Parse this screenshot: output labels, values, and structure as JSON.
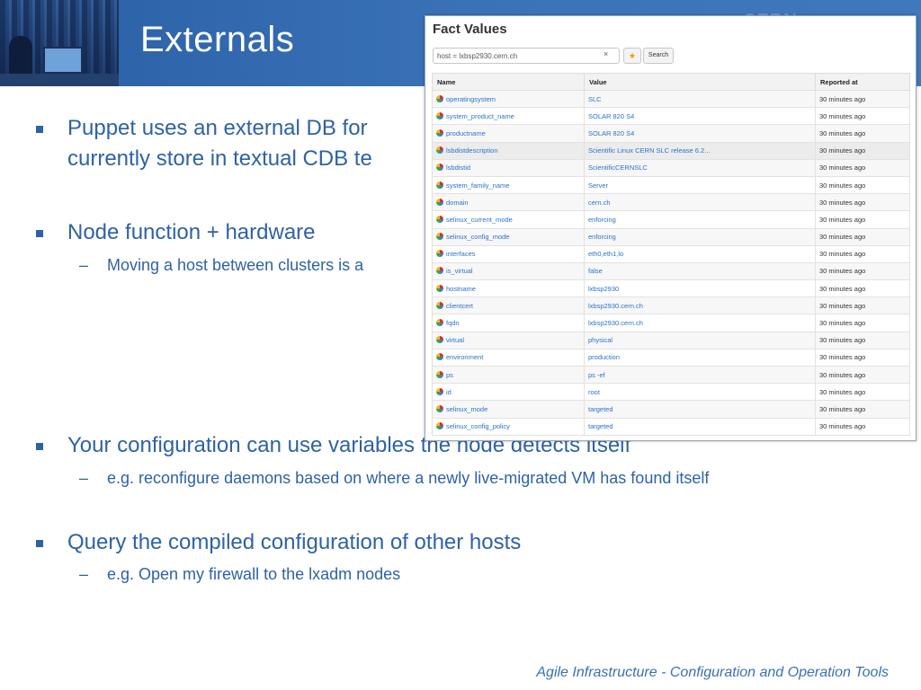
{
  "slide": {
    "title": "Externals",
    "logo_text": "CERN",
    "footer": "Agile Infrastructure - Configuration and Operation Tools",
    "bullets": [
      {
        "line1": "Puppet uses an external DB for",
        "line2": "currently store in textual CDB te"
      },
      {
        "text": "Node function + hardware",
        "sub": "Moving a host between clusters is a"
      },
      {
        "text": "Your configuration can use variables the node detects itself",
        "sub": "e.g. reconfigure daemons based on where a newly live-migrated VM has found itself"
      },
      {
        "text": "Query the compiled configuration of other hosts",
        "sub": "e.g. Open my firewall to the lxadm nodes"
      }
    ]
  },
  "fact_panel": {
    "title": "Fact Values",
    "search_value": "host = lxbsp2930.cern.ch",
    "clear_glyph": "×",
    "star_glyph": "★",
    "search_label": "Search",
    "columns": [
      "Name",
      "Value",
      "Reported at"
    ],
    "rows": [
      {
        "name": "operatingsystem",
        "value": "SLC",
        "reported": "30 minutes ago"
      },
      {
        "name": "system_product_name",
        "value": "SOLAR 820 S4",
        "reported": "30 minutes ago"
      },
      {
        "name": "productname",
        "value": "SOLAR 820 S4",
        "reported": "30 minutes ago"
      },
      {
        "name": "lsbdistdescription",
        "value": "Scientific Linux CERN SLC release 6.2...",
        "reported": "30 minutes ago"
      },
      {
        "name": "lsbdistid",
        "value": "ScientificCERNSLC",
        "reported": "30 minutes ago"
      },
      {
        "name": "system_family_name",
        "value": "Server",
        "reported": "30 minutes ago"
      },
      {
        "name": "domain",
        "value": "cern.ch",
        "reported": "30 minutes ago"
      },
      {
        "name": "selinux_current_mode",
        "value": "enforcing",
        "reported": "30 minutes ago"
      },
      {
        "name": "selinux_config_mode",
        "value": "enforcing",
        "reported": "30 minutes ago"
      },
      {
        "name": "interfaces",
        "value": "eth0,eth1,lo",
        "reported": "30 minutes ago"
      },
      {
        "name": "is_virtual",
        "value": "false",
        "reported": "30 minutes ago"
      },
      {
        "name": "hostname",
        "value": "lxbsp2930",
        "reported": "30 minutes ago"
      },
      {
        "name": "clientcert",
        "value": "lxbsp2930.cern.ch",
        "reported": "30 minutes ago"
      },
      {
        "name": "fqdn",
        "value": "lxbsp2930.cern.ch",
        "reported": "30 minutes ago"
      },
      {
        "name": "virtual",
        "value": "physical",
        "reported": "30 minutes ago"
      },
      {
        "name": "environment",
        "value": "production",
        "reported": "30 minutes ago"
      },
      {
        "name": "ps",
        "value": "ps -ef",
        "reported": "30 minutes ago"
      },
      {
        "name": "id",
        "value": "root",
        "reported": "30 minutes ago"
      },
      {
        "name": "selinux_mode",
        "value": "targeted",
        "reported": "30 minutes ago"
      },
      {
        "name": "selinux_config_policy",
        "value": "targeted",
        "reported": "30 minutes ago"
      }
    ]
  },
  "colors": {
    "header_blue": "#3b73b9",
    "text_blue": "#2e62a6",
    "link_blue": "#2a72c9"
  }
}
